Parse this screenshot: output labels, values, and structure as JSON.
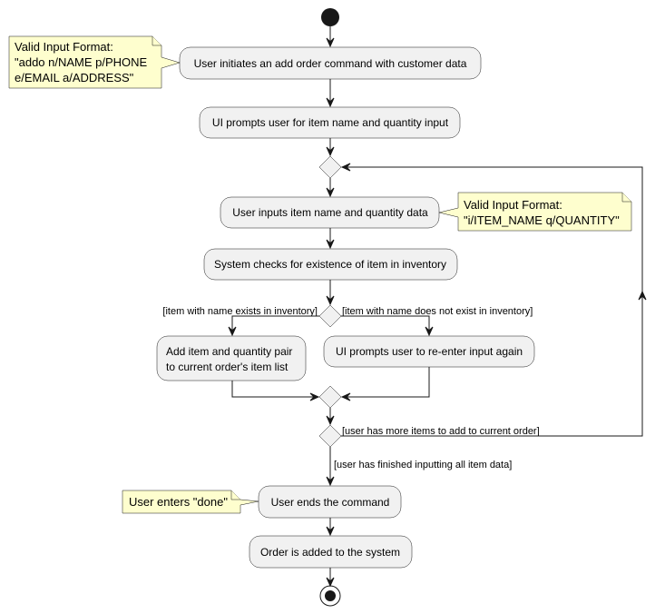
{
  "diagram": {
    "type": "activity",
    "actions": {
      "initiate": "User initiates an add order command with customer data",
      "prompt_item": "UI prompts user for item name and quantity input",
      "input_item": "User inputs item name and quantity data",
      "check_item": "System checks for existence of item in inventory",
      "add_item": [
        "Add item and quantity pair",
        "to current order's item list"
      ],
      "reprompt": "UI prompts user to re-enter input again",
      "end_command": "User ends the command",
      "order_added": "Order is added to the system"
    },
    "notes": {
      "initiate_format": [
        "Valid Input Format:",
        "\"addo n/NAME p/PHONE",
        "e/EMAIL a/ADDRESS\""
      ],
      "item_format": [
        "Valid Input Format:",
        "\"i/ITEM_NAME q/QUANTITY\""
      ],
      "done": "User enters \"done\""
    },
    "guards": {
      "exists": "[item with name exists in inventory]",
      "not_exists": "[item with name does not exist in inventory]",
      "more_items": "[user has more items to add to current order]",
      "finished": "[user has finished inputting all item data]"
    }
  }
}
